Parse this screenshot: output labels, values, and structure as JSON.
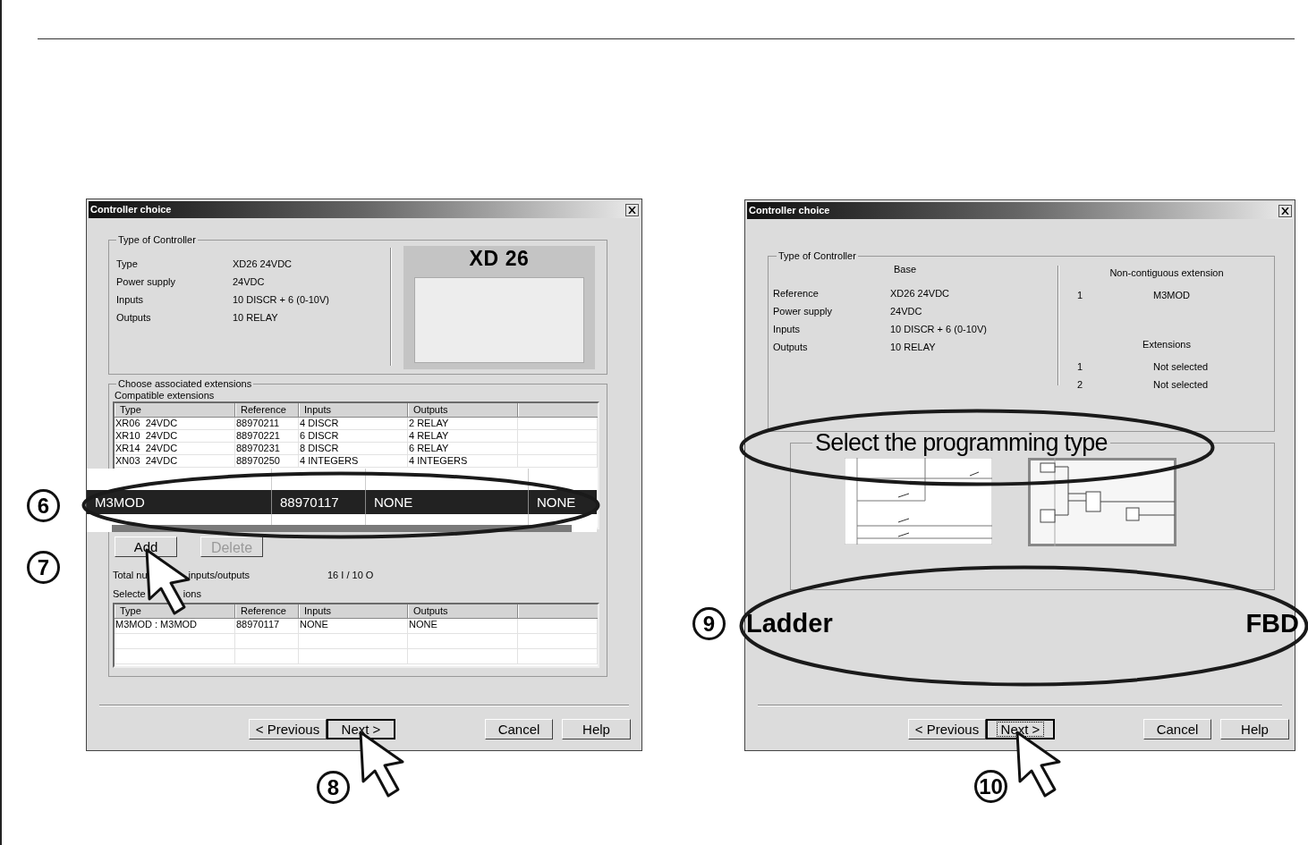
{
  "extensions_dialog": {
    "title": "Controller choice",
    "controller_group": {
      "legend": "Type of Controller",
      "rows": [
        {
          "label": "Type",
          "value": "XD26 24VDC"
        },
        {
          "label": "Power supply",
          "value": "24VDC"
        },
        {
          "label": "Inputs",
          "value": "10 DISCR + 6 (0-10V)"
        },
        {
          "label": "Outputs",
          "value": "10 RELAY"
        }
      ],
      "image_caption": "XD 26"
    },
    "extensions_group": {
      "legend": "Choose associated extensions",
      "compatible_label": "Compatible extensions",
      "compatible_table": {
        "columns": [
          "Type",
          "Reference",
          "Inputs",
          "Outputs"
        ],
        "rows": [
          [
            "XR06  24VDC",
            "88970211",
            "4 DISCR",
            "2 RELAY"
          ],
          [
            "XR10  24VDC",
            "88970221",
            "6 DISCR",
            "4 RELAY"
          ],
          [
            "XR14  24VDC",
            "88970231",
            "8 DISCR",
            "6 RELAY"
          ],
          [
            "XN03  24VDC",
            "88970250",
            "4 INTEGERS",
            "4 INTEGERS"
          ]
        ]
      },
      "zoomed_row": {
        "cells": [
          "M3MOD",
          "88970117",
          "NONE",
          "NONE"
        ],
        "selected": true
      },
      "buttons": [
        {
          "label": "Add",
          "disabled": false
        },
        {
          "label": "Delete",
          "disabled": true
        }
      ],
      "total_label_parts": [
        "Total nu",
        "inputs/outputs"
      ],
      "total_value": "16 I / 10 O",
      "selected_label_parts": [
        "Selecte",
        "ions"
      ],
      "selected_table": {
        "columns": [
          "Type",
          "Reference",
          "Inputs",
          "Outputs"
        ],
        "rows": [
          [
            "M3MOD : M3MOD",
            "88970117",
            "NONE",
            "NONE"
          ]
        ]
      }
    },
    "buttons": [
      {
        "label": "< Previous",
        "default": false,
        "focused": false
      },
      {
        "label": "Next >",
        "default": true,
        "focused": false
      },
      {
        "label": "Cancel",
        "default": false,
        "focused": false
      },
      {
        "label": "Help",
        "default": false,
        "focused": false
      }
    ]
  },
  "programming_dialog": {
    "title": "Controller choice",
    "controller_group": {
      "legend": "Type of Controller",
      "base_header": "Base",
      "rows": [
        {
          "label": "Reference",
          "value": "XD26 24VDC"
        },
        {
          "label": "Power supply",
          "value": "24VDC"
        },
        {
          "label": "Inputs",
          "value": "10 DISCR + 6 (0-10V)"
        },
        {
          "label": "Outputs",
          "value": "10 RELAY"
        }
      ],
      "extension_header": "Non-contiguous extension",
      "extension_rows": [
        {
          "index": "1",
          "value": "M3MOD"
        }
      ],
      "extensions_header": "Extensions",
      "extensions_rows": [
        {
          "index": "1",
          "value": "Not selected"
        },
        {
          "index": "2",
          "value": "Not selected"
        }
      ]
    },
    "programming_group": {
      "legend": "Select the programming type",
      "options": [
        {
          "label": "Ladder"
        },
        {
          "label": "FBD"
        }
      ]
    },
    "buttons": [
      {
        "label": "< Previous",
        "default": false,
        "focused": false
      },
      {
        "label": "Next >",
        "default": true,
        "focused": true
      },
      {
        "label": "Cancel",
        "default": false,
        "focused": false
      },
      {
        "label": "Help",
        "default": false,
        "focused": false
      }
    ]
  },
  "callouts": [
    "6",
    "7",
    "8",
    "9",
    "10"
  ]
}
